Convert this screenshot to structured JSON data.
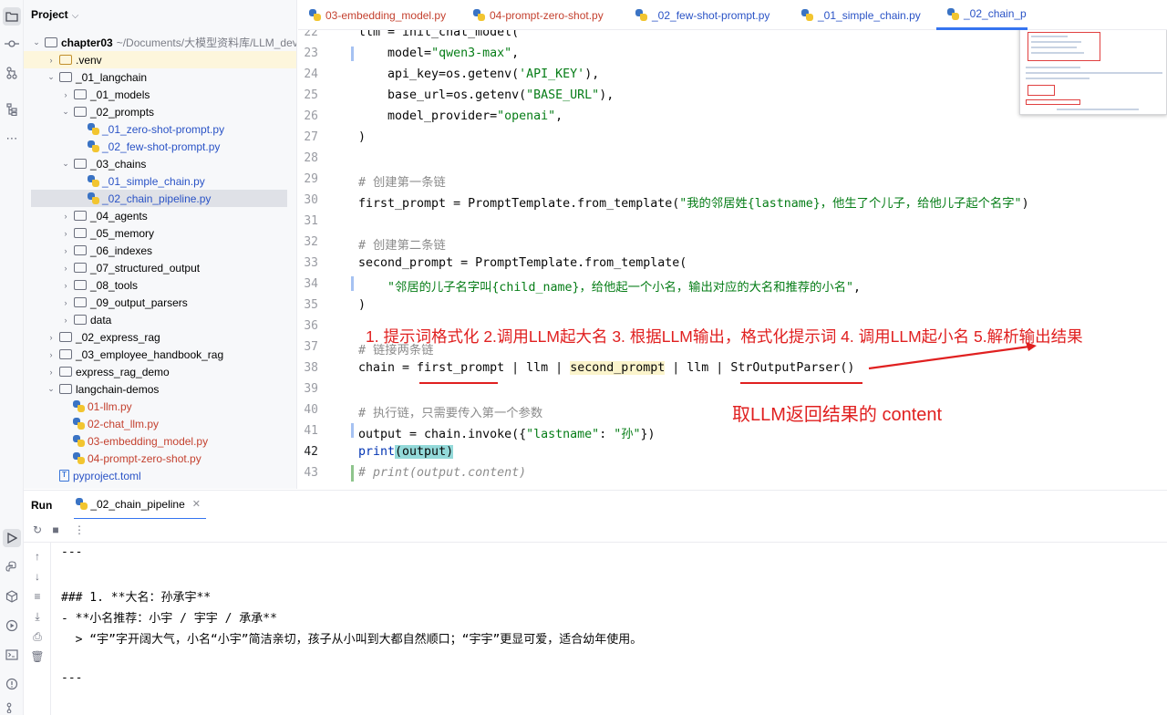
{
  "project_panel": {
    "title": "Project",
    "tree": [
      {
        "label": "chapter03",
        "path": "~/Documents/大模型资料库/LLM_dev/c",
        "bold": true
      },
      {
        "label": ".venv"
      },
      {
        "label": "_01_langchain"
      },
      {
        "label": "_01_models"
      },
      {
        "label": "_02_prompts"
      },
      {
        "label": "_01_zero-shot-prompt.py"
      },
      {
        "label": "_02_few-shot-prompt.py"
      },
      {
        "label": "_03_chains"
      },
      {
        "label": "_01_simple_chain.py"
      },
      {
        "label": "_02_chain_pipeline.py"
      },
      {
        "label": "_04_agents"
      },
      {
        "label": "_05_memory"
      },
      {
        "label": "_06_indexes"
      },
      {
        "label": "_07_structured_output"
      },
      {
        "label": "_08_tools"
      },
      {
        "label": "_09_output_parsers"
      },
      {
        "label": "data"
      },
      {
        "label": "_02_express_rag"
      },
      {
        "label": "_03_employee_handbook_rag"
      },
      {
        "label": "express_rag_demo"
      },
      {
        "label": "langchain-demos"
      },
      {
        "label": "01-llm.py"
      },
      {
        "label": "02-chat_llm.py"
      },
      {
        "label": "03-embedding_model.py"
      },
      {
        "label": "04-prompt-zero-shot.py"
      },
      {
        "label": "pyproject.toml"
      }
    ]
  },
  "tabs": [
    {
      "label": "03-embedding_model.py"
    },
    {
      "label": "04-prompt-zero-shot.py"
    },
    {
      "label": "_02_few-shot-prompt.py"
    },
    {
      "label": "_01_simple_chain.py"
    },
    {
      "label": "_02_chain_p"
    }
  ],
  "editor": {
    "line_numbers": [
      "22",
      "23",
      "24",
      "25",
      "26",
      "27",
      "28",
      "29",
      "30",
      "31",
      "32",
      "33",
      "34",
      "35",
      "36",
      "37",
      "38",
      "39",
      "40",
      "41",
      "42",
      "43"
    ],
    "code": {
      "l22": "llm = init_chat_model(",
      "l23a": "    model=",
      "l23b": "\"qwen3-max\"",
      "l23c": ",",
      "l24a": "    api_key=os.getenv(",
      "l24b": "'API_KEY'",
      "l24c": "),",
      "l25a": "    base_url=os.getenv(",
      "l25b": "\"BASE_URL\"",
      "l25c": "),",
      "l26a": "    model_provider=",
      "l26b": "\"openai\"",
      "l26c": ",",
      "l27": ")",
      "l29": "# 创建第一条链",
      "l30a": "first_prompt = PromptTemplate.from_template(",
      "l30b": "\"我的邻居姓{lastname}，他生了个儿子，给他儿子起个名字\"",
      "l30c": ")",
      "l32": "# 创建第二条链",
      "l33": "second_prompt = PromptTemplate.from_template(",
      "l34a": "    ",
      "l34b": "\"邻居的儿子名字叫{child_name}，给他起一个小名，输出对应的大名和推荐的小名\"",
      "l34c": ",",
      "l35": ")",
      "l37": "# 链接两条链",
      "l38a": "chain = ",
      "l38b": "first_prompt",
      "l38c": " | llm | ",
      "l38d": "second_prompt",
      "l38e": " | llm | StrOutputParser()",
      "l40": "# 执行链，只需要传入第一个参数",
      "l41a": "output = chain.invoke({",
      "l41b": "\"lastname\"",
      "l41c": ": ",
      "l41d": "\"孙\"",
      "l41e": "})",
      "l42a": "print",
      "l42b": "(output)",
      "l43": "# print(output.content)"
    },
    "annotations": {
      "steps": "1. 提示词格式化 2.调用LLM起大名 3. 根据LLM输出，格式化提示词 4. 调用LLM起小名 5.解析输出结果",
      "content_note": "取LLM返回结果的 content"
    }
  },
  "run_panel": {
    "title": "Run",
    "tab_label": "_02_chain_pipeline",
    "output_lines": [
      "---",
      "",
      "### 1. **大名：孙承宇**",
      "- **小名推荐：小宇 / 宇宇 / 承承**",
      "  > “宇”字开阔大气，小名“小宇”简洁亲切，孩子从小叫到大都自然顺口；“宇宇”更显可爱，适合幼年使用。",
      "",
      "---"
    ]
  },
  "colors": {
    "accent": "#3574f0",
    "annotation_red": "#e02020",
    "string_green": "#067d17",
    "comment_gray": "#8c8c8c"
  }
}
